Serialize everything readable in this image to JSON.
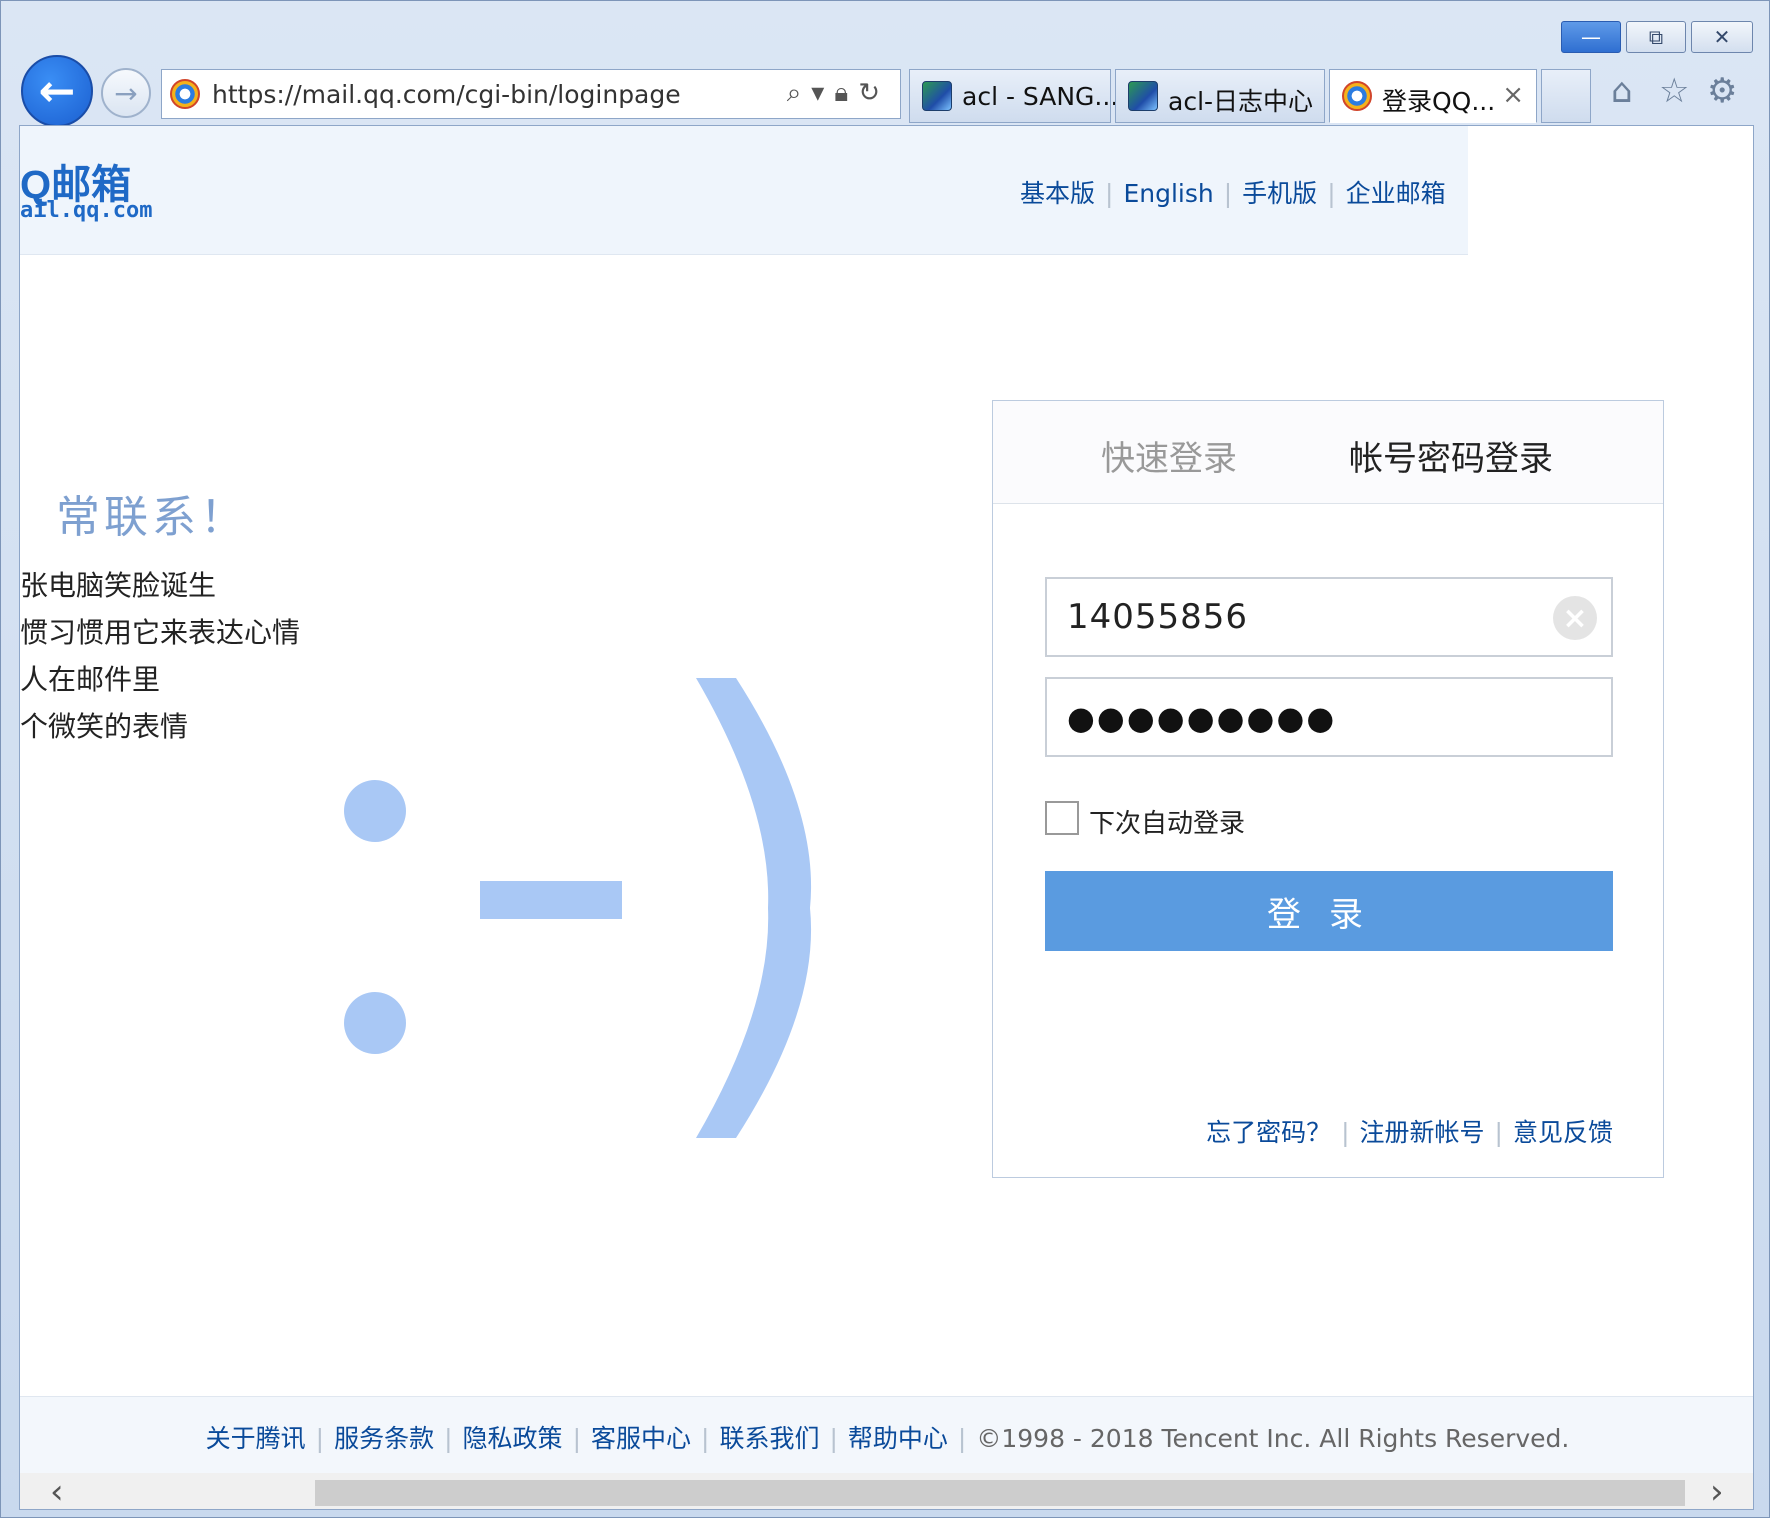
{
  "browser": {
    "url": "https://mail.qq.com/cgi-bin/loginpage",
    "tabs": [
      {
        "label": "acl - SANG..."
      },
      {
        "label": "acl-日志中心"
      },
      {
        "label": "登录QQ..."
      }
    ],
    "window_controls": {
      "minimize": "—",
      "restore": "⧉",
      "close": "✕"
    }
  },
  "header": {
    "logo": "Q邮箱",
    "logo_sub": "ail.qq.com",
    "links": [
      "基本版",
      "English",
      "手机版",
      "企业邮箱"
    ]
  },
  "promo": {
    "slogan": "常联系！",
    "lines": [
      "张电脑笑脸诞生",
      "惯习惯用它来表达心情",
      "人在邮件里",
      "个微笑的表情"
    ]
  },
  "login": {
    "tabs": {
      "quick": "快速登录",
      "account": "帐号密码登录"
    },
    "username": "14055856",
    "password_mask": "●●●●●●●●●",
    "remember_label": "下次自动登录",
    "submit_label": "登录",
    "links": [
      "忘了密码？",
      "注册新帐号",
      "意见反馈"
    ]
  },
  "footer": {
    "links": [
      "关于腾讯",
      "服务条款",
      "隐私政策",
      "客服中心",
      "联系我们",
      "帮助中心"
    ],
    "copyright": "©1998 - 2018 Tencent Inc. All Rights Reserved."
  }
}
